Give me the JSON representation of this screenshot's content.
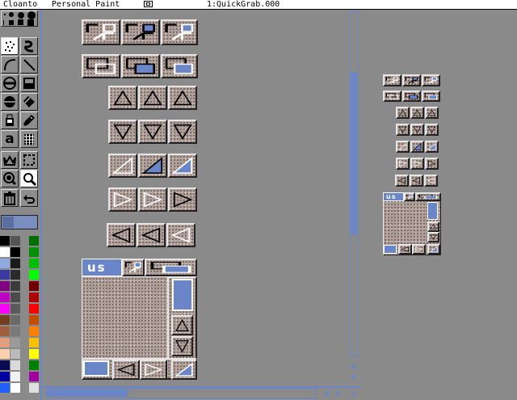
{
  "titlebar": {
    "app_name": "Cloanto",
    "app_title": "Personal Paint",
    "screen_title": "1:QuickGrab.000"
  },
  "toolbox": {
    "tools": [
      {
        "name": "brush-dots-icon"
      },
      {
        "name": "airbrush-icon"
      },
      {
        "name": "freehand-icon"
      },
      {
        "name": "curve-icon"
      },
      {
        "name": "line-icon"
      },
      {
        "name": "circle-icon"
      },
      {
        "name": "rectangle-icon"
      },
      {
        "name": "ellipse-filled-icon"
      },
      {
        "name": "polygon-icon"
      },
      {
        "name": "fill-icon"
      },
      {
        "name": "eyedropper-icon"
      },
      {
        "name": "text-icon",
        "label": "a"
      },
      {
        "name": "grid-icon"
      },
      {
        "name": "crown-icon"
      },
      {
        "name": "brush-select-icon"
      },
      {
        "name": "zoom-icon"
      },
      {
        "name": "magnify-icon"
      },
      {
        "name": "trash-icon"
      },
      {
        "name": "undo-icon"
      }
    ],
    "selected_tool": "magnify-icon"
  },
  "palette": {
    "colors": [
      "#000000",
      "#555555",
      "#007000",
      "#ffffff",
      "#000000",
      "#009000",
      "#8fa8e0",
      "#1a1a1a",
      "#00c000",
      "#3a3aa0",
      "#2a2a2a",
      "#00ff00",
      "#800080",
      "#3a3a3a",
      "#700000",
      "#c000c0",
      "#4a4a4a",
      "#b00000",
      "#ff00ff",
      "#5a5a5a",
      "#ff0000",
      "#704020",
      "#6a6a6a",
      "#c05000",
      "#a06040",
      "#7a7a7a",
      "#ff8000",
      "#e0a080",
      "#9a9a9a",
      "#ffc000",
      "#ffd0b0",
      "#bababa",
      "#ffff00",
      "#0a0a50",
      "#dadada",
      "#008000",
      "#0000a0",
      "#f0f0f0",
      "#a000a0",
      "#2060ff",
      "#ffffff",
      "#e0e0e0"
    ]
  },
  "accent_color": "#6a86c8",
  "canvas": {
    "sample_label": "us",
    "thumbnail_label": "us"
  }
}
